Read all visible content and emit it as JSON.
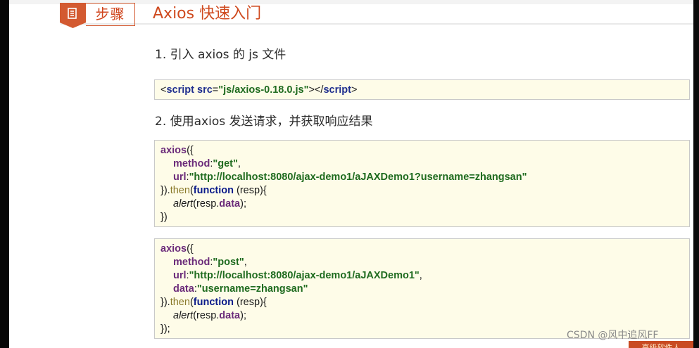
{
  "header": {
    "badge_label": "步骤",
    "title": "Axios 快速入门"
  },
  "steps": [
    {
      "heading": "1. 引入 axios 的 js 文件"
    },
    {
      "heading": "2. 使用axios 发送请求，并获取响应结果"
    }
  ],
  "code": {
    "script_tag": {
      "open_lt": "<",
      "tag": "script",
      "attr": "src",
      "eq": "=",
      "value": "\"js/axios-0.18.0.js\"",
      "close": "></",
      "tag_end": "script",
      "gt": ">"
    },
    "get_example": {
      "axios_word": "axios",
      "open": "({",
      "method_key": "method",
      "method_val": "\"get\"",
      "url_key": "url",
      "url_val": "\"http://localhost:8080/ajax-demo1/aJAXDemo1?username=zhangsan\"",
      "close_then_start": "}).",
      "then_word": "then",
      "paren": "(",
      "function_word": "function",
      "params": " (resp){",
      "alert_word": "alert",
      "alert_arg_pre": "(resp.",
      "data_word": "data",
      "alert_end": ");",
      "end": "})"
    },
    "post_example": {
      "axios_word": "axios",
      "open": "({",
      "method_key": "method",
      "method_val": "\"post\"",
      "url_key": "url",
      "url_val": "\"http://localhost:8080/ajax-demo1/aJAXDemo1\"",
      "data_key": "data",
      "data_val": "\"username=zhangsan\"",
      "close_then_start": "}).",
      "then_word": "then",
      "paren": "(",
      "function_word": "function",
      "params": " (resp){",
      "alert_word": "alert",
      "alert_arg_pre": "(resp.",
      "data_word": "data",
      "alert_end": ");",
      "end": "});"
    }
  },
  "watermark": "CSDN @风中追风FF",
  "corner_tab": "高级软件人",
  "colors": {
    "accent": "#cf4a1f",
    "code_bg": "#fefce8"
  }
}
